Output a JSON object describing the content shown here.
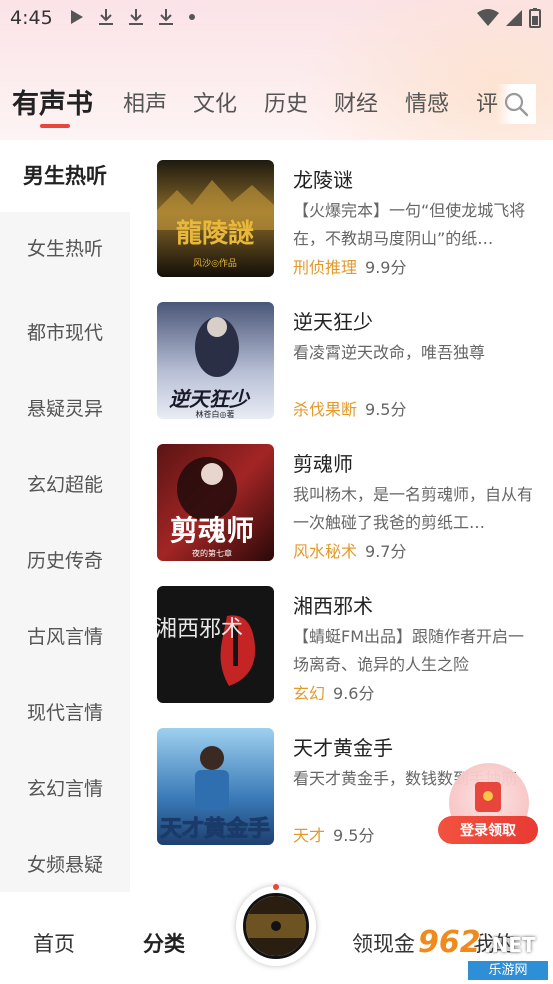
{
  "status_bar": {
    "time": "4:45",
    "left_icons": [
      "play-icon",
      "download-icon",
      "download-icon",
      "download-icon",
      "dot-icon"
    ],
    "right_icons": [
      "wifi-icon",
      "signal-icon",
      "battery-icon"
    ]
  },
  "top_tabs": [
    {
      "label": "有声书",
      "active": true
    },
    {
      "label": "相声",
      "active": false
    },
    {
      "label": "文化",
      "active": false
    },
    {
      "label": "历史",
      "active": false
    },
    {
      "label": "财经",
      "active": false
    },
    {
      "label": "情感",
      "active": false
    },
    {
      "label": "评",
      "active": false
    }
  ],
  "search_icon": "search-icon",
  "sidebar": [
    {
      "label": "男生热听",
      "active": true
    },
    {
      "label": "女生热听",
      "active": false
    },
    {
      "label": "都市现代",
      "active": false
    },
    {
      "label": "悬疑灵异",
      "active": false
    },
    {
      "label": "玄幻超能",
      "active": false
    },
    {
      "label": "历史传奇",
      "active": false
    },
    {
      "label": "古风言情",
      "active": false
    },
    {
      "label": "现代言情",
      "active": false
    },
    {
      "label": "玄幻言情",
      "active": false
    },
    {
      "label": "女频悬疑",
      "active": false
    }
  ],
  "books": [
    {
      "title": "龙陵谜",
      "desc": "【火爆完本】一句“但使龙城飞将在，不教胡马度阴山”的纸…",
      "tag": "刑侦推理",
      "score": "9.9分",
      "cover_text": "龍陵謎",
      "cover_sub": "风沙◎作品",
      "colors": {
        "bg": "#3a2a12",
        "mid": "#7a5a2a",
        "accent": "#e8b83a"
      }
    },
    {
      "title": "逆天狂少",
      "desc": "看凌霄逆天改命，唯吾独尊",
      "tag": "杀伐果断",
      "score": "9.5分",
      "cover_text": "逆天狂少",
      "cover_sub": "林苍白◎著",
      "colors": {
        "bg": "#2d3552",
        "mid": "#8a93b0",
        "accent": "#1a1a2a"
      }
    },
    {
      "title": "剪魂师",
      "desc": "我叫杨木，是一名剪魂师，自从有一次触碰了我爸的剪纸工…",
      "tag": "风水秘术",
      "score": "9.7分",
      "cover_text": "剪魂师",
      "cover_sub": "夜的第七章",
      "colors": {
        "bg": "#3a0e0e",
        "mid": "#a32525",
        "accent": "#ffffff"
      }
    },
    {
      "title": "湘西邪术",
      "desc": "【蜻蜓FM出品】跟随作者开启一场离奇、诡异的人生之险",
      "tag": "玄幻",
      "score": "9.6分",
      "cover_text": "湘西邪术",
      "cover_sub": "",
      "colors": {
        "bg": "#121212",
        "mid": "#2a2a2a",
        "accent": "#d42a2a"
      }
    },
    {
      "title": "天才黄金手",
      "desc": "看天才黄金手，数钱数到手抽筋",
      "tag": "天才",
      "score": "9.5分",
      "cover_text": "天才黄金手",
      "cover_sub": "",
      "colors": {
        "bg": "#5fa8d8",
        "mid": "#2c5f9a",
        "accent": "#f4d23a"
      }
    }
  ],
  "float_login": {
    "label": "登录领取"
  },
  "bottom_nav": [
    {
      "label": "首页",
      "active": false
    },
    {
      "label": "分类",
      "active": true
    },
    {
      "label": "领现金",
      "active": false
    },
    {
      "label": "我的",
      "active": false
    }
  ],
  "watermark": {
    "num": "962",
    "net": ".NET",
    "sub": "乐游网"
  },
  "theme": {
    "accent": "#e8463c",
    "tag_color": "#e39a2c"
  }
}
